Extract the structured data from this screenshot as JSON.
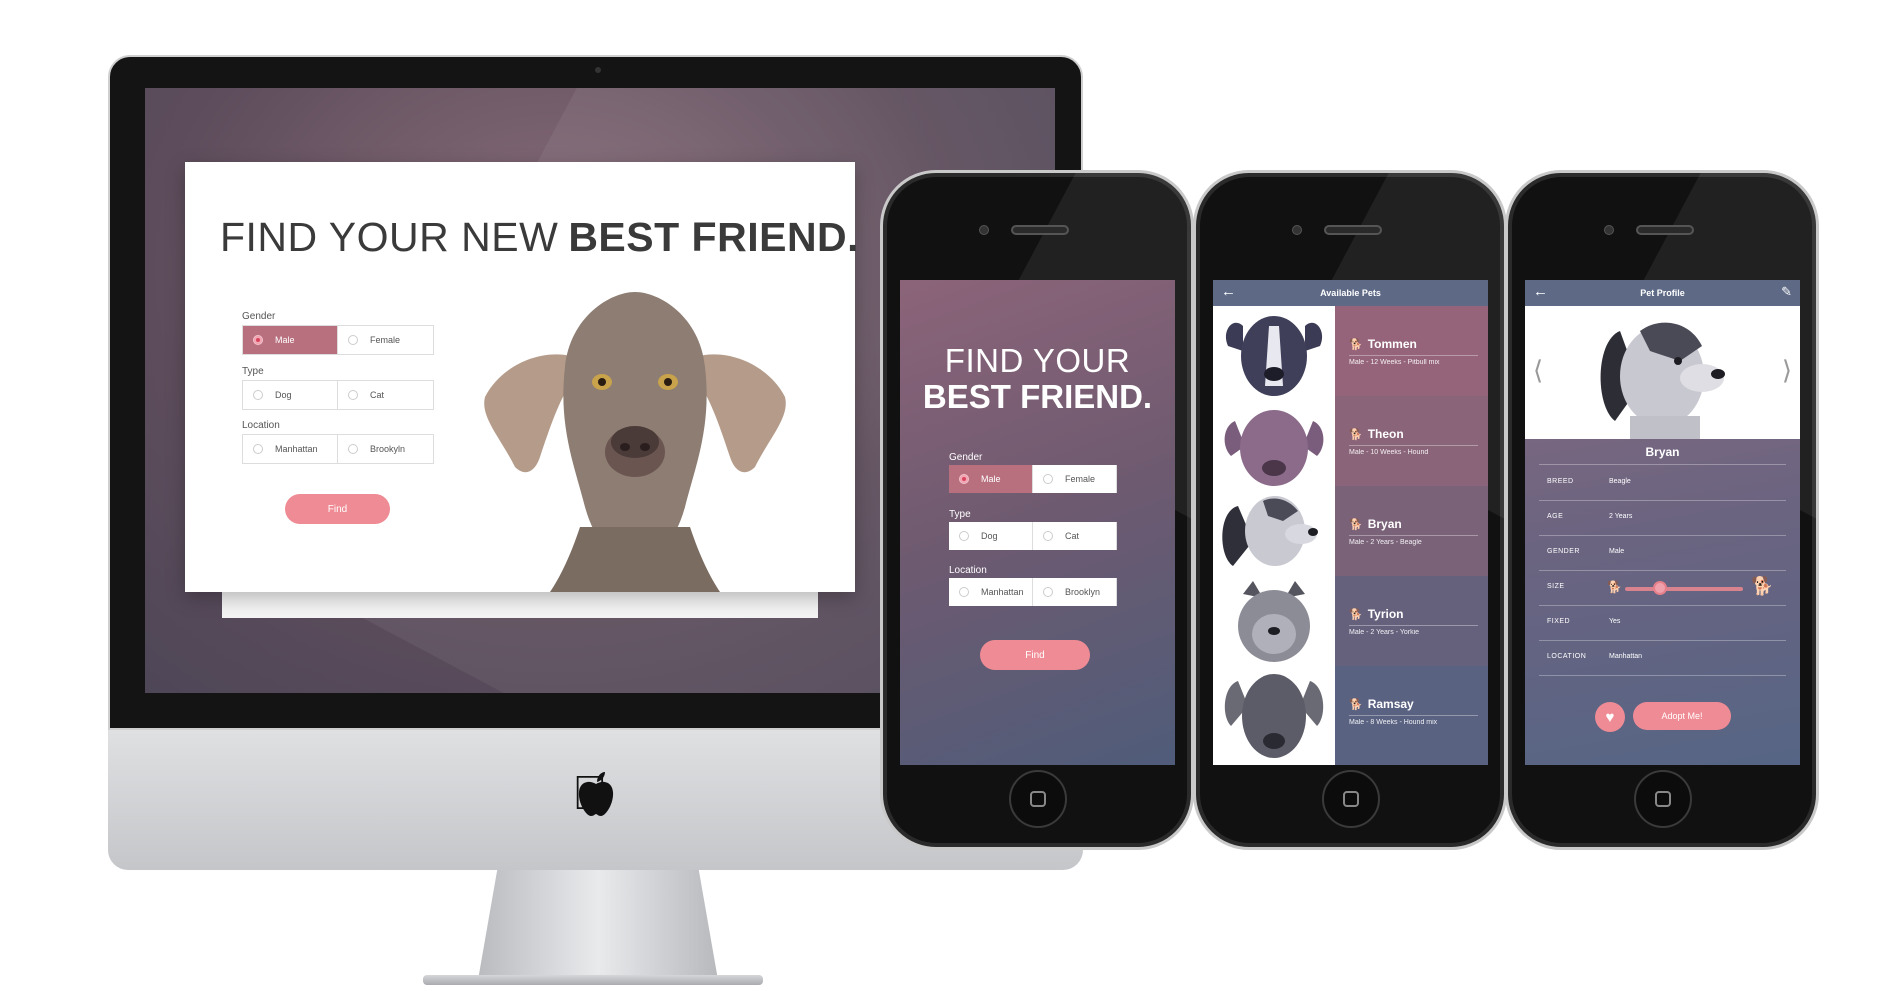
{
  "desktop": {
    "headline_light": "FIND YOUR NEW",
    "headline_bold": "BEST FRIEND.",
    "gender_label": "Gender",
    "gender_options": [
      "Male",
      "Female"
    ],
    "type_label": "Type",
    "type_options": [
      "Dog",
      "Cat"
    ],
    "location_label": "Location",
    "location_options": [
      "Manhattan",
      "Brookyln"
    ],
    "find_button": "Find"
  },
  "phone_search": {
    "headline_light": "FIND YOUR",
    "headline_bold": "BEST FRIEND.",
    "gender_label": "Gender",
    "gender_options": [
      "Male",
      "Female"
    ],
    "type_label": "Type",
    "type_options": [
      "Dog",
      "Cat"
    ],
    "location_label": "Location",
    "location_options": [
      "Manhattan",
      "Brooklyn"
    ],
    "find_button": "Find"
  },
  "available_pets": {
    "title": "Available Pets",
    "pets": [
      {
        "name": "Tommen",
        "meta": "Male - 12 Weeks - Pitbull mix",
        "color": "#95647a"
      },
      {
        "name": "Theon",
        "meta": "Male - 10 Weeks - Hound",
        "color": "#8a6479"
      },
      {
        "name": "Bryan",
        "meta": "Male - 2 Years - Beagle",
        "color": "#7a6279"
      },
      {
        "name": "Tyrion",
        "meta": "Male - 2 Years - Yorkie",
        "color": "#65617d"
      },
      {
        "name": "Ramsay",
        "meta": "Male - 8 Weeks - Hound mix",
        "color": "#5a6282"
      }
    ]
  },
  "pet_profile": {
    "title": "Pet Profile",
    "name": "Bryan",
    "fields": [
      {
        "key": "BREED",
        "value": "Beagle"
      },
      {
        "key": "AGE",
        "value": "2 Years"
      },
      {
        "key": "GENDER",
        "value": "Male"
      },
      {
        "key": "SIZE",
        "value": ""
      },
      {
        "key": "FIXED",
        "value": "Yes"
      },
      {
        "key": "LOCATION",
        "value": "Manhattan"
      }
    ],
    "size_level": 0.3,
    "adopt_button": "Adopt Me!"
  },
  "colors": {
    "accent_pink": "#ef8b94",
    "selected_mauve": "#b8707e",
    "header_slate": "#5d6985"
  },
  "icons": [
    "apple-logo-icon",
    "back-arrow-icon",
    "edit-icon",
    "paw-icon",
    "heart-icon",
    "chevron-left-icon",
    "chevron-right-icon",
    "small-dog-icon",
    "large-dog-icon"
  ]
}
